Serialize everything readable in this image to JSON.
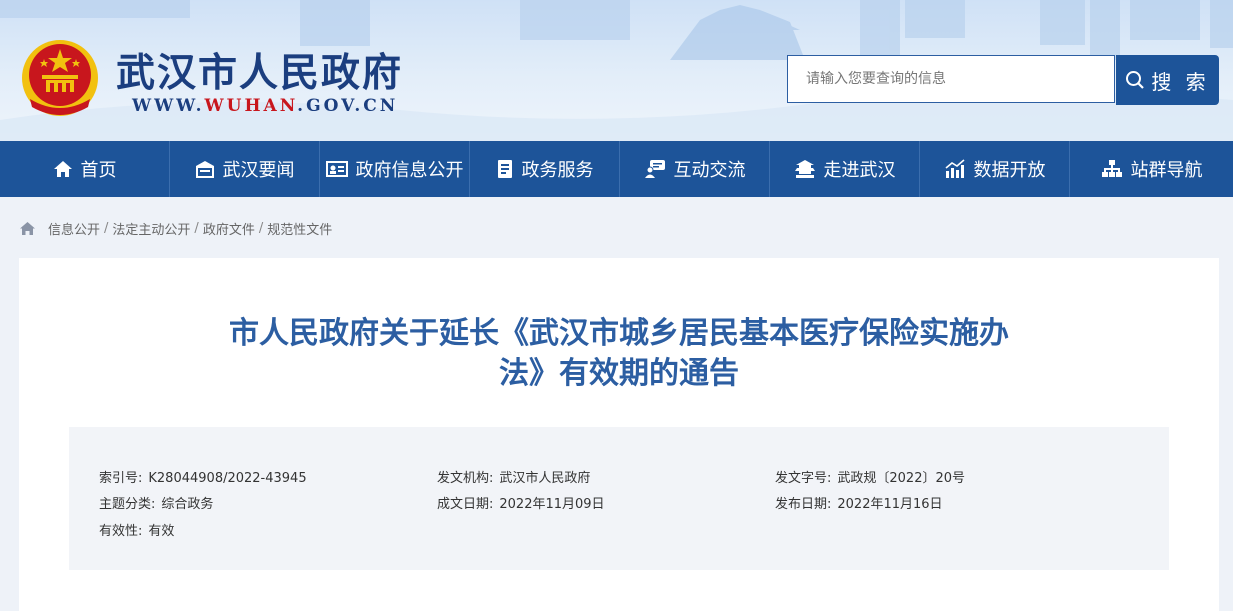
{
  "header": {
    "site_title": "武汉市人民政府",
    "url_prefix": "WWW.",
    "url_highlight": "WUHAN",
    "url_suffix": ".GOV.CN",
    "search_placeholder": "请输入您要查询的信息",
    "search_button": "搜 索"
  },
  "nav": {
    "items": [
      {
        "label": "首页",
        "icon": "home-icon"
      },
      {
        "label": "武汉要闻",
        "icon": "building-icon"
      },
      {
        "label": "政府信息公开",
        "icon": "id-card-icon"
      },
      {
        "label": "政务服务",
        "icon": "document-icon"
      },
      {
        "label": "互动交流",
        "icon": "chat-user-icon"
      },
      {
        "label": "走进武汉",
        "icon": "pagoda-icon"
      },
      {
        "label": "数据开放",
        "icon": "bar-chart-icon"
      },
      {
        "label": "站群导航",
        "icon": "sitemap-icon"
      }
    ]
  },
  "breadcrumb": {
    "items": [
      "信息公开",
      "法定主动公开",
      "政府文件",
      "规范性文件"
    ],
    "separator": "/"
  },
  "article": {
    "title_line1": "市人民政府关于延长《武汉市城乡居民基本医疗保险实施办",
    "title_line2": "法》有效期的通告",
    "meta": {
      "index_label": "索引号:",
      "index_value": "K28044908/2022-43945",
      "issuer_label": "发文机构:",
      "issuer_value": "武汉市人民政府",
      "doc_no_label": "发文字号:",
      "doc_no_value": "武政规〔2022〕20号",
      "topic_label": "主题分类:",
      "topic_value": "综合政务",
      "written_label": "成文日期:",
      "written_value": "2022年11月09日",
      "published_label": "发布日期:",
      "published_value": "2022年11月16日",
      "validity_label": "有效性:",
      "validity_value": "有效"
    }
  },
  "colors": {
    "nav_bg": "#1d5499",
    "title_blue": "#2c5ea2",
    "brand_dark": "#1b3e7f",
    "url_red": "#c8161d",
    "emblem_red": "#c8161d",
    "emblem_gold": "#f2c10f"
  }
}
